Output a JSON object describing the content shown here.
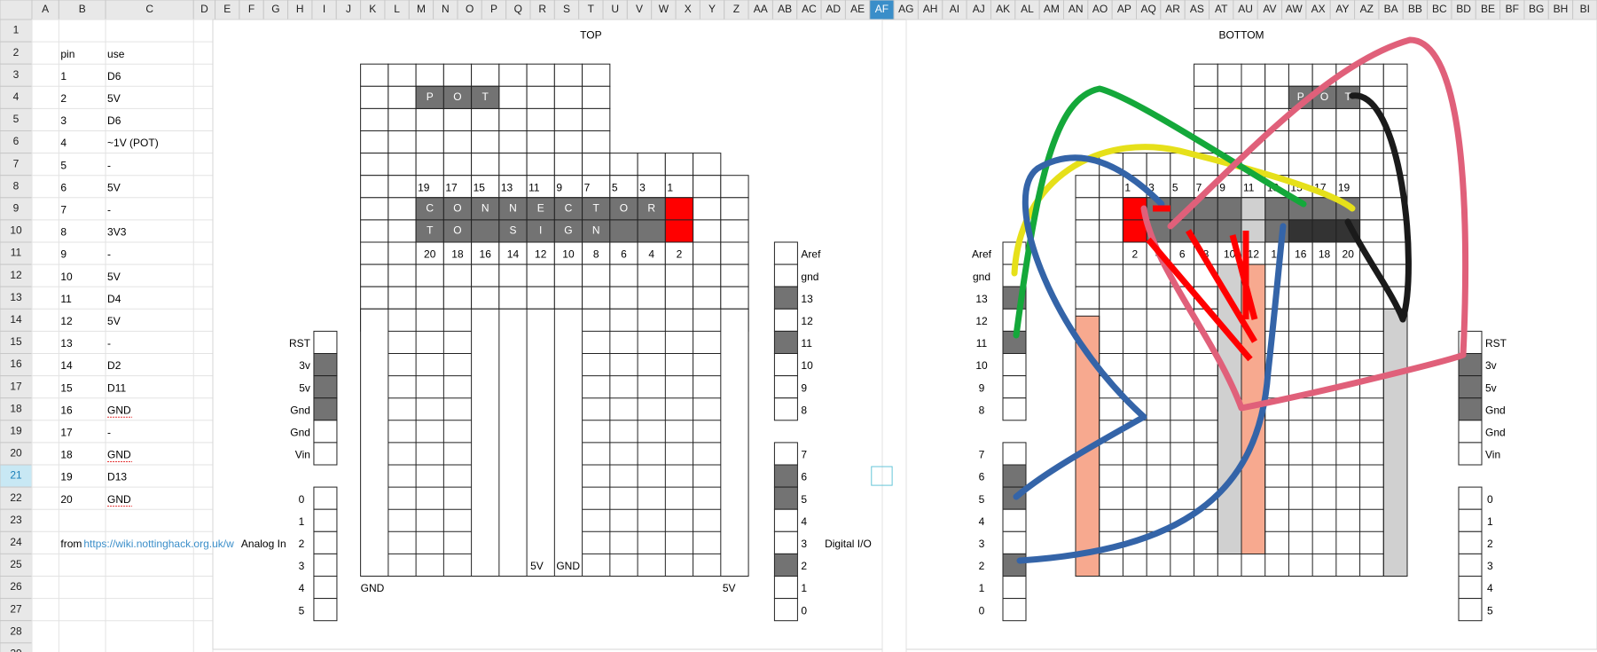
{
  "column_headers": [
    "A",
    "B",
    "C",
    "D",
    "E",
    "F",
    "G",
    "H",
    "I",
    "J",
    "K",
    "L",
    "M",
    "N",
    "O",
    "P",
    "Q",
    "R",
    "S",
    "T",
    "U",
    "V",
    "W",
    "X",
    "Y",
    "Z",
    "AA",
    "AB",
    "AC",
    "AD",
    "AE",
    "AF",
    "AG",
    "AH",
    "AI",
    "AJ",
    "AK",
    "AL",
    "AM",
    "AN",
    "AO",
    "AP",
    "AQ",
    "AR",
    "AS",
    "AT",
    "AU",
    "AV",
    "AW",
    "AX",
    "AY",
    "AZ",
    "BA",
    "BB",
    "BC",
    "BD",
    "BE",
    "BF",
    "BG",
    "BH",
    "BI"
  ],
  "row_headers": [
    "1",
    "2",
    "3",
    "4",
    "5",
    "6",
    "7",
    "8",
    "9",
    "10",
    "11",
    "12",
    "13",
    "14",
    "15",
    "16",
    "17",
    "18",
    "19",
    "20",
    "21",
    "22",
    "23",
    "24",
    "25",
    "26",
    "27",
    "28",
    "29"
  ],
  "selection": {
    "column": "AF",
    "row": "21"
  },
  "pin_table": {
    "headers": {
      "pin": "pin",
      "use": "use"
    },
    "rows": [
      {
        "pin": "1",
        "use": "D6"
      },
      {
        "pin": "2",
        "use": "5V"
      },
      {
        "pin": "3",
        "use": "D6"
      },
      {
        "pin": "4",
        "use": "~1V (POT)"
      },
      {
        "pin": "5",
        "use": "-"
      },
      {
        "pin": "6",
        "use": "5V"
      },
      {
        "pin": "7",
        "use": "-"
      },
      {
        "pin": "8",
        "use": "3V3"
      },
      {
        "pin": "9",
        "use": "-"
      },
      {
        "pin": "10",
        "use": "5V"
      },
      {
        "pin": "11",
        "use": "D4"
      },
      {
        "pin": "12",
        "use": "5V"
      },
      {
        "pin": "13",
        "use": "-"
      },
      {
        "pin": "14",
        "use": "D2"
      },
      {
        "pin": "15",
        "use": "D11"
      },
      {
        "pin": "16",
        "use": "GND"
      },
      {
        "pin": "17",
        "use": "-"
      },
      {
        "pin": "18",
        "use": "GND"
      },
      {
        "pin": "19",
        "use": "D13"
      },
      {
        "pin": "20",
        "use": "GND"
      }
    ],
    "source_prefix": "from",
    "source_link": "https://wiki.nottinghack.org.uk/w"
  },
  "top": {
    "title": "TOP",
    "pot_letters": [
      "P",
      "O",
      "T"
    ],
    "connector_letters": [
      "C",
      "O",
      "N",
      "N",
      "E",
      "C",
      "T",
      "O",
      "R"
    ],
    "sign_letters": [
      "T",
      "O",
      "",
      "S",
      "I",
      "G",
      "N"
    ],
    "odd_pins": [
      "19",
      "17",
      "15",
      "13",
      "11",
      "9",
      "7",
      "5",
      "3",
      "1"
    ],
    "even_pins": [
      "20",
      "18",
      "16",
      "14",
      "12",
      "10",
      "8",
      "6",
      "4",
      "2"
    ],
    "bottom_labels": {
      "gnd": "GND",
      "five_v": "5V",
      "mid_five_v": "5V",
      "mid_gnd": "GND"
    }
  },
  "bottom": {
    "title": "BOTTOM",
    "pot_letters": [
      "P",
      "O",
      "T"
    ],
    "odd_pins": [
      "1",
      "3",
      "5",
      "7",
      "9",
      "11",
      "13",
      "15",
      "17",
      "19"
    ],
    "even_pins": [
      "2",
      "4",
      "6",
      "8",
      "10",
      "12",
      "14",
      "16",
      "18",
      "20"
    ]
  },
  "analog": {
    "label": "Analog In",
    "power_labels": [
      "RST",
      "3v",
      "5v",
      "Gnd",
      "Gnd",
      "Vin"
    ],
    "pins": [
      "0",
      "1",
      "2",
      "3",
      "4",
      "5"
    ]
  },
  "digital": {
    "label": "Digital I/O",
    "upper_labels": [
      "Aref",
      "gnd",
      "13",
      "12",
      "11",
      "10",
      "9",
      "8"
    ],
    "lower_labels": [
      "7",
      "6",
      "5",
      "4",
      "3",
      "2",
      "1",
      "0"
    ]
  },
  "colors": {
    "grid": "#222222",
    "grey": "#737373",
    "red": "#ff0000",
    "salmon": "#f7a98f",
    "lightgrey": "#d0d0d0",
    "header_bg": "#e8e8e8",
    "selected": "#3a8ec9"
  }
}
